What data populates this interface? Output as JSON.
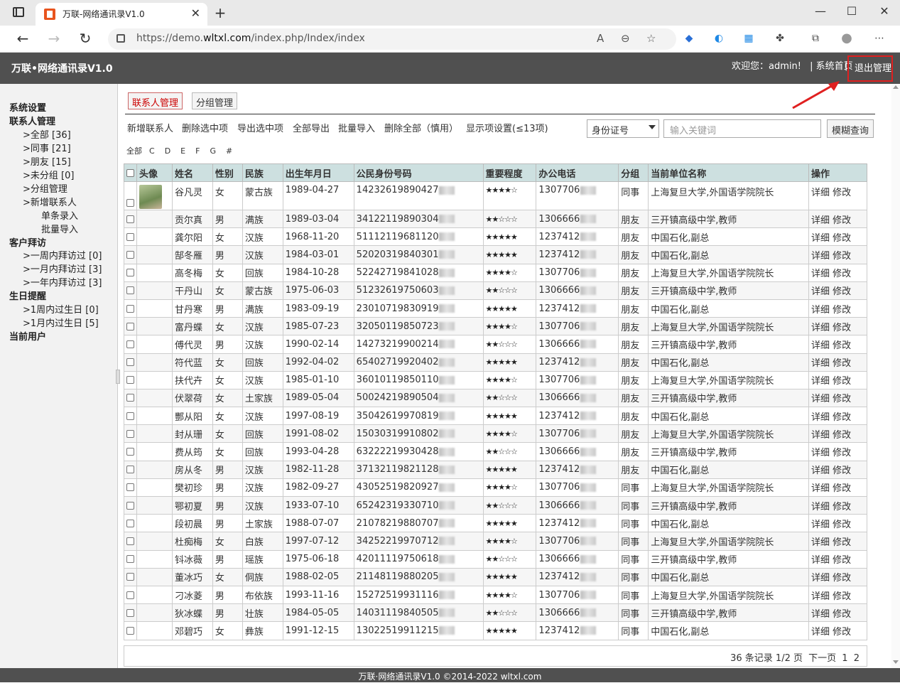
{
  "browser": {
    "tab_title": "万联-网络通讯录V1.0",
    "url_prefix": "https://demo.",
    "url_domain": "wltxl.com",
    "url_path": "/index.php/Index/index"
  },
  "header": {
    "brand": "万联•网络通讯录V1.0",
    "welcome": "欢迎您：admin!",
    "sep1": "|",
    "home": "系统首页",
    "sep2": "|",
    "logout": "退出管理"
  },
  "sidebar": {
    "system": "系统设置",
    "contact_mgmt": "联系人管理",
    "all": ">全部 [36]",
    "colleague": ">同事 [21]",
    "friend": ">朋友 [15]",
    "ungrouped": ">未分组 [0]",
    "group_mgmt": ">分组管理",
    "new_contact": ">新增联系人",
    "single": "单条录入",
    "batch": "批量导入",
    "visit": "客户拜访",
    "visit_week": ">一周内拜访过 [0]",
    "visit_month": ">一月内拜访过 [3]",
    "visit_year": ">一年内拜访过 [3]",
    "birthday": "生日提醒",
    "bday_week": ">1周内过生日 [0]",
    "bday_month": ">1月内过生日 [5]",
    "current_user": "当前用户"
  },
  "tabs": {
    "contacts": "联系人管理",
    "groups": "分组管理"
  },
  "actions": {
    "add": "新增联系人",
    "delete_sel": "删除选中项",
    "export_sel": "导出选中项",
    "export_all": "全部导出",
    "import": "批量导入",
    "delete_all": "删除全部（慎用）",
    "display": "显示项设置(≤13项)"
  },
  "search": {
    "field": "身份证号",
    "placeholder": "输入关键词",
    "button": "模糊查询"
  },
  "letters": [
    "全部",
    "C",
    "D",
    "E",
    "F",
    "G",
    "#"
  ],
  "table": {
    "headers": [
      "头像",
      "姓名",
      "性别",
      "民族",
      "出生年月日",
      "公民身份号码",
      "重要程度",
      "办公电话",
      "分组",
      "当前单位名称",
      "操作"
    ],
    "rows": [
      {
        "name": "谷凡灵",
        "gender": "女",
        "ethnic": "蒙古族",
        "birth": "1989-04-27",
        "id": "14232619890427",
        "stars": "★★★★☆",
        "phone": "1307706",
        "group": "同事",
        "org": "上海复旦大学,外国语学院院长"
      },
      {
        "name": "贡尔真",
        "gender": "男",
        "ethnic": "满族",
        "birth": "1989-03-04",
        "id": "34122119890304",
        "stars": "★★☆☆☆",
        "phone": "1306666",
        "group": "朋友",
        "org": "三开镇高级中学,教师"
      },
      {
        "name": "龚尔阳",
        "gender": "女",
        "ethnic": "汉族",
        "birth": "1968-11-20",
        "id": "51112119681120",
        "stars": "★★★★★",
        "phone": "1237412",
        "group": "朋友",
        "org": "中国石化,副总"
      },
      {
        "name": "郜冬雁",
        "gender": "男",
        "ethnic": "汉族",
        "birth": "1984-03-01",
        "id": "52020319840301",
        "stars": "★★★★★",
        "phone": "1237412",
        "group": "朋友",
        "org": "中国石化,副总"
      },
      {
        "name": "高冬梅",
        "gender": "女",
        "ethnic": "回族",
        "birth": "1984-10-28",
        "id": "52242719841028",
        "stars": "★★★★☆",
        "phone": "1307706",
        "group": "朋友",
        "org": "上海复旦大学,外国语学院院长"
      },
      {
        "name": "干丹山",
        "gender": "女",
        "ethnic": "蒙古族",
        "birth": "1975-06-03",
        "id": "51232619750603",
        "stars": "★★☆☆☆",
        "phone": "1306666",
        "group": "朋友",
        "org": "三开镇高级中学,教师"
      },
      {
        "name": "甘丹寒",
        "gender": "男",
        "ethnic": "满族",
        "birth": "1983-09-19",
        "id": "23010719830919",
        "stars": "★★★★★",
        "phone": "1237412",
        "group": "朋友",
        "org": "中国石化,副总"
      },
      {
        "name": "富丹蝶",
        "gender": "女",
        "ethnic": "汉族",
        "birth": "1985-07-23",
        "id": "32050119850723",
        "stars": "★★★★☆",
        "phone": "1307706",
        "group": "朋友",
        "org": "上海复旦大学,外国语学院院长"
      },
      {
        "name": "傅代灵",
        "gender": "男",
        "ethnic": "汉族",
        "birth": "1990-02-14",
        "id": "14273219900214",
        "stars": "★★☆☆☆",
        "phone": "1306666",
        "group": "朋友",
        "org": "三开镇高级中学,教师"
      },
      {
        "name": "符代蓝",
        "gender": "女",
        "ethnic": "回族",
        "birth": "1992-04-02",
        "id": "65402719920402",
        "stars": "★★★★★",
        "phone": "1237412",
        "group": "朋友",
        "org": "中国石化,副总"
      },
      {
        "name": "扶代卉",
        "gender": "女",
        "ethnic": "汉族",
        "birth": "1985-01-10",
        "id": "36010119850110",
        "stars": "★★★★☆",
        "phone": "1307706",
        "group": "朋友",
        "org": "上海复旦大学,外国语学院院长"
      },
      {
        "name": "伏翠荷",
        "gender": "女",
        "ethnic": "土家族",
        "birth": "1989-05-04",
        "id": "50024219890504",
        "stars": "★★☆☆☆",
        "phone": "1306666",
        "group": "朋友",
        "org": "三开镇高级中学,教师"
      },
      {
        "name": "酆从阳",
        "gender": "女",
        "ethnic": "汉族",
        "birth": "1997-08-19",
        "id": "35042619970819",
        "stars": "★★★★★",
        "phone": "1237412",
        "group": "朋友",
        "org": "中国石化,副总"
      },
      {
        "name": "封从珊",
        "gender": "女",
        "ethnic": "回族",
        "birth": "1991-08-02",
        "id": "15030319910802",
        "stars": "★★★★☆",
        "phone": "1307706",
        "group": "朋友",
        "org": "上海复旦大学,外国语学院院长"
      },
      {
        "name": "费从筠",
        "gender": "女",
        "ethnic": "回族",
        "birth": "1993-04-28",
        "id": "63222219930428",
        "stars": "★★☆☆☆",
        "phone": "1306666",
        "group": "朋友",
        "org": "三开镇高级中学,教师"
      },
      {
        "name": "房从冬",
        "gender": "男",
        "ethnic": "汉族",
        "birth": "1982-11-28",
        "id": "37132119821128",
        "stars": "★★★★★",
        "phone": "1237412",
        "group": "朋友",
        "org": "中国石化,副总"
      },
      {
        "name": "樊初珍",
        "gender": "男",
        "ethnic": "汉族",
        "birth": "1982-09-27",
        "id": "43052519820927",
        "stars": "★★★★☆",
        "phone": "1307706",
        "group": "同事",
        "org": "上海复旦大学,外国语学院院长"
      },
      {
        "name": "鄂初夏",
        "gender": "男",
        "ethnic": "汉族",
        "birth": "1933-07-10",
        "id": "65242319330710",
        "stars": "★★☆☆☆",
        "phone": "1306666",
        "group": "同事",
        "org": "三开镇高级中学,教师"
      },
      {
        "name": "段初晨",
        "gender": "男",
        "ethnic": "土家族",
        "birth": "1988-07-07",
        "id": "21078219880707",
        "stars": "★★★★★",
        "phone": "1237412",
        "group": "同事",
        "org": "中国石化,副总"
      },
      {
        "name": "杜痴梅",
        "gender": "女",
        "ethnic": "白族",
        "birth": "1997-07-12",
        "id": "34252219970712",
        "stars": "★★★★☆",
        "phone": "1307706",
        "group": "同事",
        "org": "上海复旦大学,外国语学院院长"
      },
      {
        "name": "钭冰薇",
        "gender": "男",
        "ethnic": "瑶族",
        "birth": "1975-06-18",
        "id": "42011119750618",
        "stars": "★★☆☆☆",
        "phone": "1306666",
        "group": "同事",
        "org": "三开镇高级中学,教师"
      },
      {
        "name": "董冰巧",
        "gender": "女",
        "ethnic": "侗族",
        "birth": "1988-02-05",
        "id": "21148119880205",
        "stars": "★★★★★",
        "phone": "1237412",
        "group": "同事",
        "org": "中国石化,副总"
      },
      {
        "name": "刁冰菱",
        "gender": "男",
        "ethnic": "布依族",
        "birth": "1993-11-16",
        "id": "15272519931116",
        "stars": "★★★★☆",
        "phone": "1307706",
        "group": "同事",
        "org": "上海复旦大学,外国语学院院长"
      },
      {
        "name": "狄冰蝶",
        "gender": "男",
        "ethnic": "壮族",
        "birth": "1984-05-05",
        "id": "14031119840505",
        "stars": "★★☆☆☆",
        "phone": "1306666",
        "group": "同事",
        "org": "三开镇高级中学,教师"
      },
      {
        "name": "邓碧巧",
        "gender": "女",
        "ethnic": "彝族",
        "birth": "1991-12-15",
        "id": "13022519911215",
        "stars": "★★★★★",
        "phone": "1237412",
        "group": "同事",
        "org": "中国石化,副总"
      }
    ],
    "op_detail": "详细",
    "op_edit": "修改"
  },
  "pager": {
    "summary": "36 条记录 1/2 页",
    "next": "下一页",
    "p1": "1",
    "p2": "2"
  },
  "footer": "万联·网络通讯录V1.0 ©2014-2022 wltxl.com"
}
